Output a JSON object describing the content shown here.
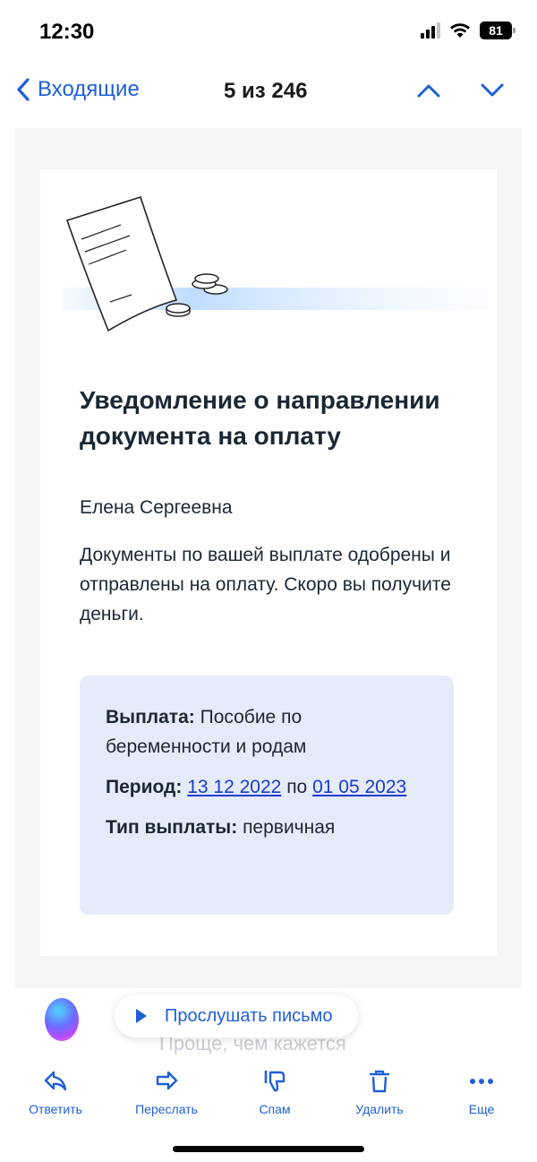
{
  "status_bar": {
    "time": "12:30",
    "battery": "81"
  },
  "nav": {
    "back_label": "Входящие",
    "counter": "5 из 246"
  },
  "mail": {
    "title": "Уведомление о направлении документа на оплату",
    "greeting": "Елена Сергеевна",
    "paragraph": "Документы по вашей выплате одобрены и отправлены на оплату. Скоро вы получите деньги.",
    "info": {
      "payment_label": "Выплата:",
      "payment_value": "Пособие по беременности и родам",
      "period_label": "Период:",
      "period_from": "13 12 2022",
      "period_sep": "по",
      "period_to": "01 05 2023",
      "type_label": "Тип выплаты:",
      "type_value": "первичная"
    }
  },
  "listen": {
    "label": "Прослушать письмо",
    "faded_text": "Проще, чем кажется"
  },
  "toolbar": {
    "reply": "Ответить",
    "forward": "Переслать",
    "spam": "Спам",
    "delete": "Удалить",
    "more": "Еще"
  },
  "colors": {
    "accent": "#1e5fd8",
    "info_bg": "#e5ebf9",
    "link": "#1a3bd0"
  }
}
